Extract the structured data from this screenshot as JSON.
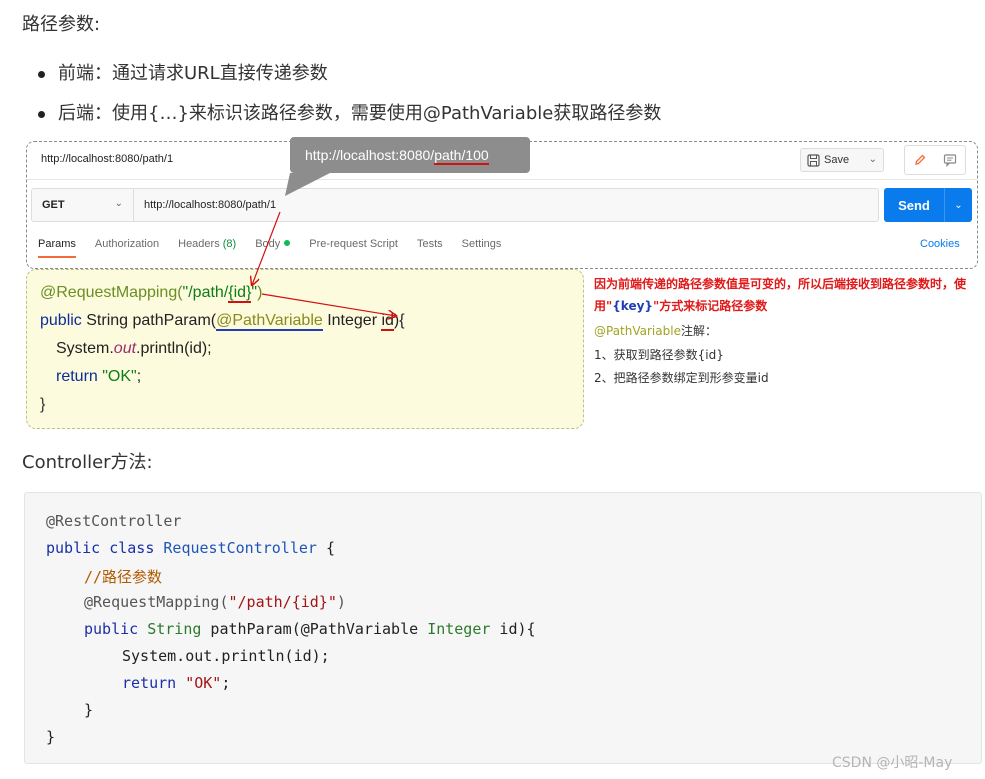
{
  "heading_params": "路径参数:",
  "bullets": [
    "前端：通过请求URL直接传递参数",
    "后端：使用{…}来标识该路径参数，需要使用@PathVariable获取路径参数"
  ],
  "postman": {
    "tab_url": "http://localhost:8080/path/1",
    "save_label": "Save",
    "method": "GET",
    "request_url": "http://localhost:8080/path/1",
    "send_label": "Send",
    "tabs": {
      "params": "Params",
      "authorization": "Authorization",
      "headers": "Headers",
      "headers_count": "(8)",
      "body": "Body",
      "prerequest": "Pre-request Script",
      "tests": "Tests",
      "settings": "Settings"
    },
    "cookies": "Cookies",
    "tooltip_prefix": "http://localhost:8080/",
    "tooltip_highlight": "path/100",
    "colors": {
      "send": "#097bed",
      "active_tab": "#f26b3a"
    }
  },
  "yellow_code": {
    "l1_ann": "@RequestMapping(",
    "l1_str_a": "\"/path/",
    "l1_id": "{id}",
    "l1_str_b": "\"",
    "l1_end": ")",
    "l2_kw": "public",
    "l2_type": " String pathParam(",
    "l2_pv": "@PathVariable",
    "l2_mid": " Integer ",
    "l2_id": "id",
    "l2_end": "){",
    "l3_a": "System.",
    "l3_out": "out",
    "l3_b": ".println(id);",
    "l4_kw": "return ",
    "l4_str": "\"OK\"",
    "l4_end": ";",
    "l5": "}"
  },
  "side_note": {
    "red_a": "因为前端传递的路径参数值是可变的，所以后端接收到路径参数时，使用\"",
    "red_key": "{key}",
    "red_b": "\"方式来标记路径参数",
    "anno_name": "@PathVariable",
    "anno_suffix": "注解：",
    "item1": "1、获取到路径参数{id}",
    "item2": "2、把路径参数绑定到形参变量id"
  },
  "heading_controller": "Controller方法:",
  "code": {
    "l1": "@RestController",
    "l2_kw": "public class ",
    "l2_cls": "RequestController",
    "l2_end": " {",
    "l3": "//路径参数",
    "l4_ann": "@RequestMapping(",
    "l4_str": "\"/path/{id}\"",
    "l4_end": ")",
    "l5_kw": "public ",
    "l5_typ": "String",
    "l5_mid": " pathParam(@PathVariable ",
    "l5_typ2": "Integer",
    "l5_end": " id){",
    "l6": "System.out.println(id);",
    "l7_kw": "return ",
    "l7_str": "\"OK\"",
    "l7_end": ";",
    "l8": "}",
    "l9": "}"
  },
  "watermark": "CSDN @小昭-May"
}
